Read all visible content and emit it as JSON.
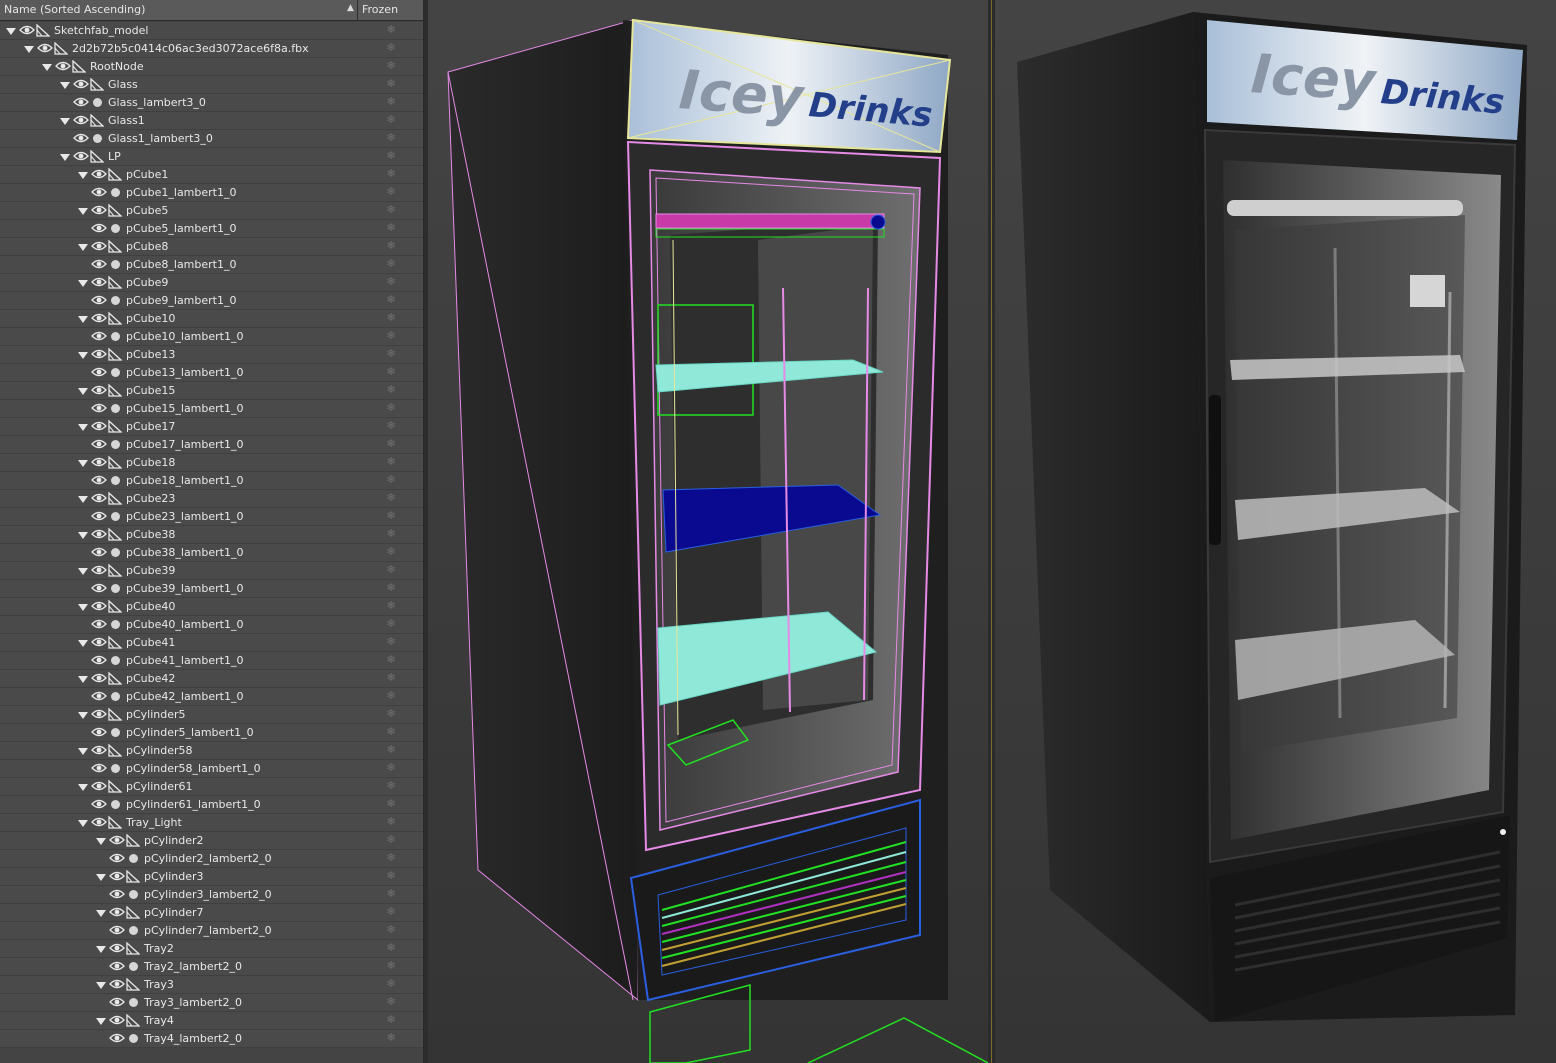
{
  "scene_explorer": {
    "header": {
      "name_column": "Name (Sorted Ascending)",
      "sort_indicator": "▲",
      "frozen_column": "Frozen"
    },
    "frozen_glyph": "❄",
    "rows": [
      {
        "label": "Sketchfab_model",
        "level": 0,
        "expanded": true,
        "type": "group"
      },
      {
        "label": "2d2b72b5c0414c06ac3ed3072ace6f8a.fbx",
        "level": 1,
        "expanded": true,
        "type": "group"
      },
      {
        "label": "RootNode",
        "level": 2,
        "expanded": true,
        "type": "group"
      },
      {
        "label": "Glass",
        "level": 3,
        "expanded": true,
        "type": "group"
      },
      {
        "label": "Glass_lambert3_0",
        "level": 4,
        "type": "mesh"
      },
      {
        "label": "Glass1",
        "level": 3,
        "expanded": true,
        "type": "group"
      },
      {
        "label": "Glass1_lambert3_0",
        "level": 4,
        "type": "mesh"
      },
      {
        "label": "LP",
        "level": 3,
        "expanded": true,
        "type": "group"
      },
      {
        "label": "pCube1",
        "level": 4,
        "expanded": true,
        "type": "group"
      },
      {
        "label": "pCube1_lambert1_0",
        "level": 5,
        "type": "mesh"
      },
      {
        "label": "pCube5",
        "level": 4,
        "expanded": true,
        "type": "group"
      },
      {
        "label": "pCube5_lambert1_0",
        "level": 5,
        "type": "mesh"
      },
      {
        "label": "pCube8",
        "level": 4,
        "expanded": true,
        "type": "group"
      },
      {
        "label": "pCube8_lambert1_0",
        "level": 5,
        "type": "mesh"
      },
      {
        "label": "pCube9",
        "level": 4,
        "expanded": true,
        "type": "group"
      },
      {
        "label": "pCube9_lambert1_0",
        "level": 5,
        "type": "mesh"
      },
      {
        "label": "pCube10",
        "level": 4,
        "expanded": true,
        "type": "group"
      },
      {
        "label": "pCube10_lambert1_0",
        "level": 5,
        "type": "mesh"
      },
      {
        "label": "pCube13",
        "level": 4,
        "expanded": true,
        "type": "group"
      },
      {
        "label": "pCube13_lambert1_0",
        "level": 5,
        "type": "mesh"
      },
      {
        "label": "pCube15",
        "level": 4,
        "expanded": true,
        "type": "group"
      },
      {
        "label": "pCube15_lambert1_0",
        "level": 5,
        "type": "mesh"
      },
      {
        "label": "pCube17",
        "level": 4,
        "expanded": true,
        "type": "group"
      },
      {
        "label": "pCube17_lambert1_0",
        "level": 5,
        "type": "mesh"
      },
      {
        "label": "pCube18",
        "level": 4,
        "expanded": true,
        "type": "group"
      },
      {
        "label": "pCube18_lambert1_0",
        "level": 5,
        "type": "mesh"
      },
      {
        "label": "pCube23",
        "level": 4,
        "expanded": true,
        "type": "group"
      },
      {
        "label": "pCube23_lambert1_0",
        "level": 5,
        "type": "mesh"
      },
      {
        "label": "pCube38",
        "level": 4,
        "expanded": true,
        "type": "group"
      },
      {
        "label": "pCube38_lambert1_0",
        "level": 5,
        "type": "mesh"
      },
      {
        "label": "pCube39",
        "level": 4,
        "expanded": true,
        "type": "group"
      },
      {
        "label": "pCube39_lambert1_0",
        "level": 5,
        "type": "mesh"
      },
      {
        "label": "pCube40",
        "level": 4,
        "expanded": true,
        "type": "group"
      },
      {
        "label": "pCube40_lambert1_0",
        "level": 5,
        "type": "mesh"
      },
      {
        "label": "pCube41",
        "level": 4,
        "expanded": true,
        "type": "group"
      },
      {
        "label": "pCube41_lambert1_0",
        "level": 5,
        "type": "mesh"
      },
      {
        "label": "pCube42",
        "level": 4,
        "expanded": true,
        "type": "group"
      },
      {
        "label": "pCube42_lambert1_0",
        "level": 5,
        "type": "mesh"
      },
      {
        "label": "pCylinder5",
        "level": 4,
        "expanded": true,
        "type": "group"
      },
      {
        "label": "pCylinder5_lambert1_0",
        "level": 5,
        "type": "mesh"
      },
      {
        "label": "pCylinder58",
        "level": 4,
        "expanded": true,
        "type": "group"
      },
      {
        "label": "pCylinder58_lambert1_0",
        "level": 5,
        "type": "mesh"
      },
      {
        "label": "pCylinder61",
        "level": 4,
        "expanded": true,
        "type": "group"
      },
      {
        "label": "pCylinder61_lambert1_0",
        "level": 5,
        "type": "mesh"
      },
      {
        "label": "Tray_Light",
        "level": 4,
        "expanded": true,
        "type": "group"
      },
      {
        "label": "pCylinder2",
        "level": 5,
        "expanded": true,
        "type": "group"
      },
      {
        "label": "pCylinder2_lambert2_0",
        "level": 6,
        "type": "mesh"
      },
      {
        "label": "pCylinder3",
        "level": 5,
        "expanded": true,
        "type": "group"
      },
      {
        "label": "pCylinder3_lambert2_0",
        "level": 6,
        "type": "mesh"
      },
      {
        "label": "pCylinder7",
        "level": 5,
        "expanded": true,
        "type": "group"
      },
      {
        "label": "pCylinder7_lambert2_0",
        "level": 6,
        "type": "mesh"
      },
      {
        "label": "Tray2",
        "level": 5,
        "expanded": true,
        "type": "group"
      },
      {
        "label": "Tray2_lambert2_0",
        "level": 6,
        "type": "mesh"
      },
      {
        "label": "Tray3",
        "level": 5,
        "expanded": true,
        "type": "group"
      },
      {
        "label": "Tray3_lambert2_0",
        "level": 6,
        "type": "mesh"
      },
      {
        "label": "Tray4",
        "level": 5,
        "expanded": true,
        "type": "group"
      },
      {
        "label": "Tray4_lambert2_0",
        "level": 6,
        "type": "mesh"
      }
    ]
  },
  "viewports": {
    "left": {
      "mode": "wireframe-over-shaded",
      "sign_word1": "Icey",
      "sign_word2": "Drinks"
    },
    "right": {
      "mode": "shaded",
      "sign_word1": "Icey",
      "sign_word2": "Drinks"
    }
  },
  "colors": {
    "panel_bg": "#4a4a4a",
    "header_bg": "#5a5a5a",
    "viewport_bg": "#3c3c3c",
    "wire_pink": "#e58ae5",
    "wire_yellow": "#e6e69a",
    "wire_green": "#22e022",
    "wire_cyan": "#8fe8d8",
    "wire_blue": "#0a0a90",
    "wire_frame_blue": "#2a5fe0",
    "sign_blue": "#233f8a"
  }
}
